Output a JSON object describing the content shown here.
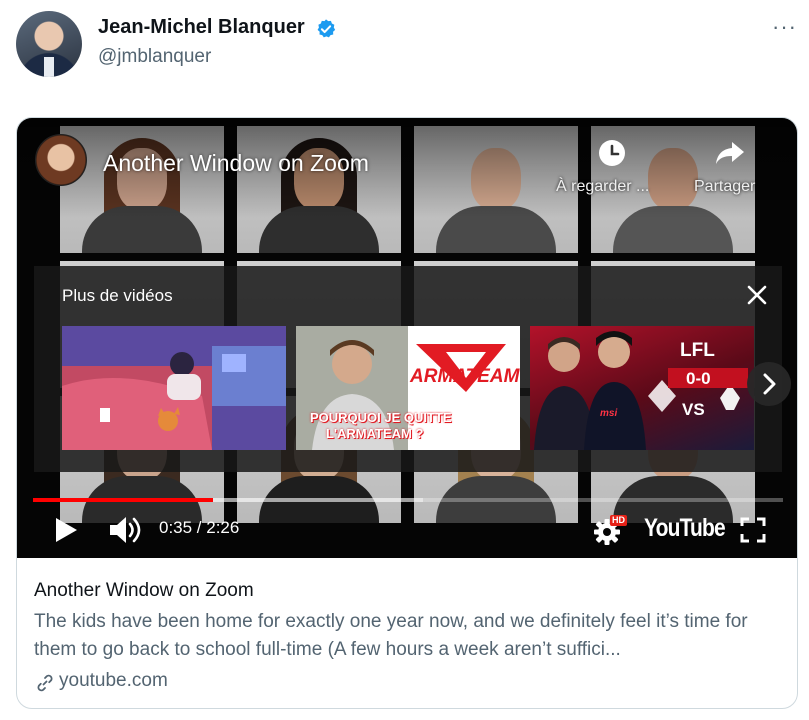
{
  "tweet": {
    "author_name": "Jean-Michel Blanquer",
    "author_handle": "@jmblanquer",
    "more_icon": "more-horizontal-icon",
    "verified_color": "#1d9bf0"
  },
  "video": {
    "title": "Another Window on Zoom",
    "watch_later_label": "À regarder ...",
    "share_label": "Partager",
    "more_videos_title": "Plus de vidéos",
    "thumbnails": [
      {
        "overlay_text": ""
      },
      {
        "logo_text": "ARMATEAM",
        "caption_line1": "POURQUOI JE QUITTE",
        "caption_line2": "L'ARMATEAM ?"
      },
      {
        "league_text": "LFL",
        "score_text": "0-0",
        "vs_text": "VS",
        "brand_text": "msi"
      }
    ],
    "time_display": "0:35 / 2:26",
    "progress": 0.24,
    "buffered": 0.52,
    "hd_badge": "HD",
    "logo_text": "YouTube",
    "accent_color": "#ff0000"
  },
  "card": {
    "title": "Another Window on Zoom",
    "description": "The kids have been home for exactly one year now, and we definitely feel it’s time for them to go back to school full-time (A few hours a week aren’t suffici...",
    "domain": "youtube.com"
  }
}
